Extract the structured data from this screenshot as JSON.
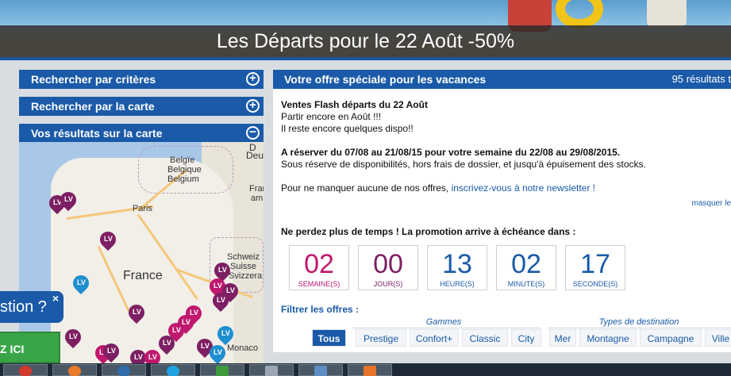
{
  "banner": {
    "title": "Les Départs pour le 22 Août -50%"
  },
  "left_panel": {
    "search_criteria_label": "Rechercher par critères",
    "search_map_label": "Rechercher par la carte",
    "map_results_label": "Vos résultats sur la carte",
    "plus_icon": "+",
    "minus_icon": "−"
  },
  "map": {
    "labels": [
      "Belgïe",
      "Belgique",
      "Belgium",
      "Paris",
      "France",
      "Schweiz",
      "Suisse",
      "Svizzera",
      "Frank",
      "am",
      "Deu",
      "D",
      "Monaco"
    ],
    "marker_colors": {
      "purple": "#7d1f63",
      "pink": "#c0186e",
      "blue": "#1e8fd0"
    }
  },
  "offer": {
    "header_title": "Votre offre spéciale pour les vacances",
    "result_count": "95 résultats t",
    "line1": "Ventes Flash départs du 22 Août",
    "line2": "Partir encore en Août !!!",
    "line3": "Il reste encore quelques dispo!!",
    "line4": "A réserver du 07/08 au 21/08/15 pour votre semaine du 22/08 au 29/08/2015.",
    "line5": "Sous réserve de disponibilités, hors frais de dossier, et jusqu'à épuisement des stocks.",
    "newsletter_prefix": "Pour ne manquer aucune de nos offres, ",
    "newsletter_link": "inscrivez-vous à notre newsletter !",
    "hide_link": "masquer le",
    "countdown_title": "Ne perdez plus de temps ! La promotion arrive à échéance dans :",
    "countdown": [
      {
        "value": "02",
        "unit": "SEMAINE(S)",
        "color": "#c0186e",
        "unit_color": "#c0186e"
      },
      {
        "value": "00",
        "unit": "JOUR(S)",
        "color": "#7d1f63",
        "unit_color": "#7d1f63"
      },
      {
        "value": "13",
        "unit": "HEURE(S)",
        "color": "#1a5aa8",
        "unit_color": "#1a5aa8"
      },
      {
        "value": "02",
        "unit": "MINUTE(S)",
        "color": "#1a5aa8",
        "unit_color": "#1a5aa8"
      },
      {
        "value": "17",
        "unit": "SECONDE(S)",
        "color": "#1a5aa8",
        "unit_color": "#1a5aa8"
      }
    ],
    "filter_title": "Filtrer les offres :",
    "group_gammes": "Gammes",
    "group_types": "Types de destination",
    "filters": [
      "Tous",
      "Prestige",
      "Confort+",
      "Classic",
      "City",
      "Mer",
      "Montagne",
      "Campagne",
      "Ville"
    ]
  },
  "help_widget": {
    "question_text": "stion ?",
    "close_icon": "×",
    "cta_text": "Z ICI"
  },
  "taskbar": {
    "icons": [
      "chrome-icon",
      "firefox-icon",
      "app-icon",
      "skype-icon",
      "paint-icon",
      "editor-icon",
      "window-icon",
      "office-icon"
    ]
  }
}
